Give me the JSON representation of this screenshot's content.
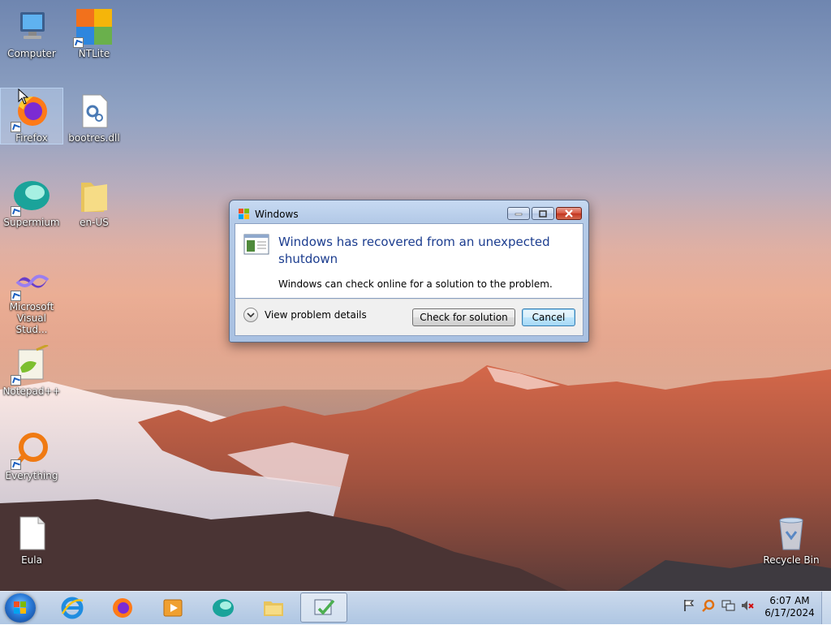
{
  "desktop": {
    "icons": [
      {
        "label": "Computer",
        "icon": "computer-icon"
      },
      {
        "label": "NTLite",
        "icon": "ntlite-icon"
      },
      {
        "label": "Firefox",
        "icon": "firefox-icon"
      },
      {
        "label": "bootres.dll",
        "icon": "dll-file-icon"
      },
      {
        "label": "Supermium",
        "icon": "supermium-icon"
      },
      {
        "label": "en-US",
        "icon": "folder-icon"
      },
      {
        "label": "Microsoft Visual Stud...",
        "icon": "visual-studio-icon"
      },
      {
        "label": "Notepad++",
        "icon": "notepadpp-icon"
      },
      {
        "label": "Everything",
        "icon": "everything-icon"
      },
      {
        "label": "Eula",
        "icon": "text-file-icon"
      },
      {
        "label": "Recycle Bin",
        "icon": "recycle-bin-icon"
      }
    ]
  },
  "dialog": {
    "title": "Windows",
    "main_instruction": "Windows has recovered from an unexpected shutdown",
    "content": "Windows can check online for a solution to the problem.",
    "details_label": "View problem details",
    "check_button": "Check for solution",
    "cancel_button": "Cancel"
  },
  "taskbar": {
    "apps": [
      "internet-explorer-icon",
      "firefox-icon",
      "media-player-icon",
      "supermium-icon",
      "explorer-folder-icon",
      "action-center-app-icon"
    ],
    "tray_icons": [
      "flag-icon",
      "search-tray-icon",
      "network-icon",
      "volume-muted-icon"
    ],
    "time": "6:07 AM",
    "date": "6/17/2024"
  },
  "colors": {
    "heading_blue": "#1c3d8f",
    "default_button_border": "#3c7fb1",
    "close_button_red": "#c23520"
  }
}
